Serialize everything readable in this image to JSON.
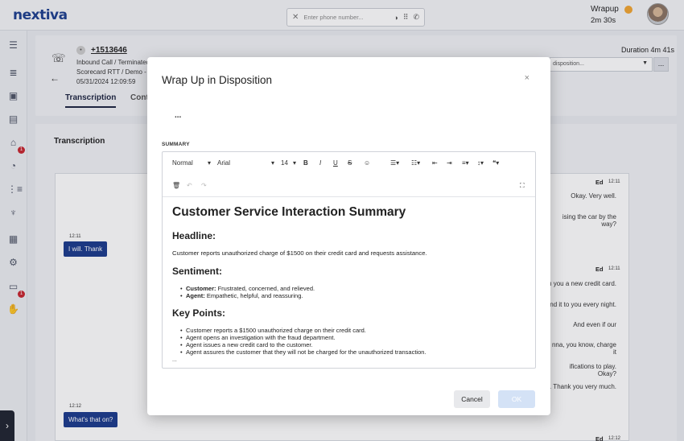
{
  "app": {
    "logo": "nextiva"
  },
  "header": {
    "phone_placeholder": "Enter phone number...",
    "status_label": "Wrapup",
    "status_timer": "2m 30s",
    "status_color": "#f2a531"
  },
  "sidebar": {
    "icons": [
      "menu-icon",
      "list-icon",
      "contact-card-icon",
      "document-icon",
      "home-icon",
      "pie-chart-icon",
      "queue-icon",
      "microphone-icon",
      "widgets-icon",
      "gear-hand-icon",
      "id-card-icon",
      "hand-icon"
    ],
    "badges": {
      "home": "1",
      "id_card": "1"
    }
  },
  "call": {
    "number": "+1513646",
    "line1": "Inbound Call / Terminated",
    "line2": "Scorecard RTT / Demo - N",
    "datetime": "05/31/2024 12:09:59",
    "duration": "Duration 4m 41s",
    "disposition_placeholder": "disposition...",
    "more_label": "...",
    "tabs": [
      "Transcription",
      "Cont"
    ]
  },
  "transcription": {
    "title": "Transcription",
    "left_messages": [
      {
        "time": "12:11",
        "text": "I will. Thank"
      },
      {
        "time": "12:12",
        "text": "What's that on?"
      }
    ],
    "right_speaker": "Ed",
    "right_times": [
      "12:11",
      "12:11",
      "12:12"
    ],
    "right_lines": [
      "Okay. Very well.",
      "ising the car by the way?",
      "ı you a new credit card.",
      "nd it to you every night.",
      "And even if our",
      "nna, you know, charge it",
      "ifications to play. Okay?",
      ". Thank you very much."
    ]
  },
  "modal": {
    "title": "Wrap Up in Disposition",
    "close": "×",
    "ellipsis": "...",
    "summary_label": "SUMMARY",
    "toolbar": {
      "style": "Normal",
      "font": "Arial",
      "size": "14",
      "bold": "B",
      "italic": "I",
      "underline": "U",
      "strike": "S"
    },
    "content": {
      "h1": "Customer Service Interaction Summary",
      "headline_heading": "Headline:",
      "headline_text": "Customer reports unauthorized charge of $1500 on their credit card and requests assistance.",
      "sentiment_heading": "Sentiment:",
      "sentiment_customer_label": "Customer:",
      "sentiment_customer_text": " Frustrated, concerned, and relieved.",
      "sentiment_agent_label": "Agent:",
      "sentiment_agent_text": " Empathetic, helpful, and reassuring.",
      "keypoints_heading": "Key Points:",
      "keypoints": [
        "Customer reports a $1500 unauthorized charge on their credit card.",
        "Agent opens an investigation with the fraud department.",
        "Agent issues a new credit card to the customer.",
        "Agent assures the customer that they will not be charged for the unauthorized transaction."
      ],
      "more": "..."
    },
    "cancel_label": "Cancel",
    "ok_label": "OK"
  }
}
